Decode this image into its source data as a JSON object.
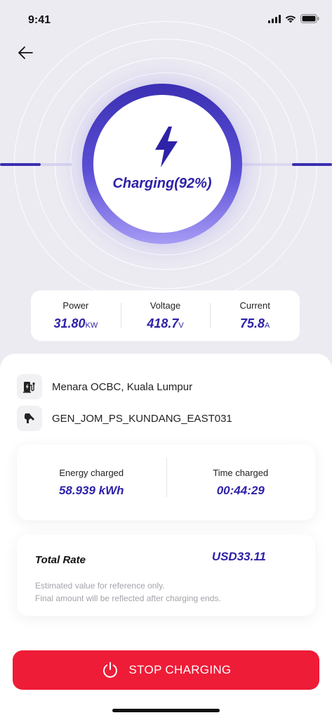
{
  "status_bar": {
    "time": "9:41"
  },
  "charging": {
    "label": "Charging(92%)",
    "percent": 92
  },
  "metrics": [
    {
      "label": "Power",
      "value": "31.80",
      "unit": "KW"
    },
    {
      "label": "Voltage",
      "value": "418.7",
      "unit": "V"
    },
    {
      "label": "Current",
      "value": "75.8",
      "unit": "A"
    }
  ],
  "station": {
    "location": "Menara OCBC, Kuala Lumpur",
    "charger_id": "GEN_JOM_PS_KUNDANG_EAST031"
  },
  "energy": {
    "energy_label": "Energy charged",
    "energy_value": "58.939 kWh",
    "time_label": "Time charged",
    "time_value": "00:44:29"
  },
  "rate": {
    "title": "Total Rate",
    "value": "USD33.11",
    "note_line1": "Estimated value for reference only.",
    "note_line2": "Final amount will be reflected after charging ends."
  },
  "actions": {
    "stop_label": "STOP CHARGING"
  },
  "colors": {
    "accent": "#2e22a8",
    "danger": "#ee1c37",
    "background": "#ecebf2"
  }
}
